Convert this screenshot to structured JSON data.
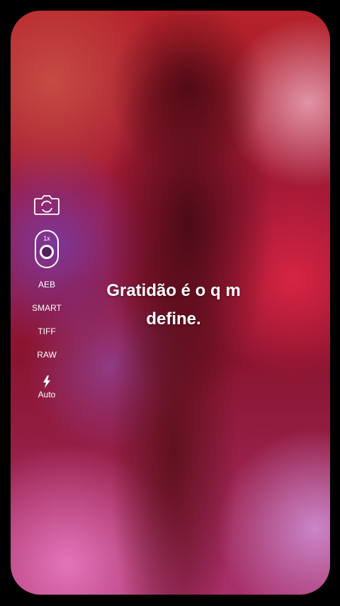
{
  "caption": "Gratidão é o q m\ndefine.",
  "camera_controls": {
    "switch_camera_icon": "camera-switch-icon",
    "zoom_label": "1x",
    "modes": [
      "AEB",
      "SMART",
      "TIFF",
      "RAW"
    ],
    "flash_icon": "lightning-bolt-icon",
    "flash_label": "Auto"
  }
}
